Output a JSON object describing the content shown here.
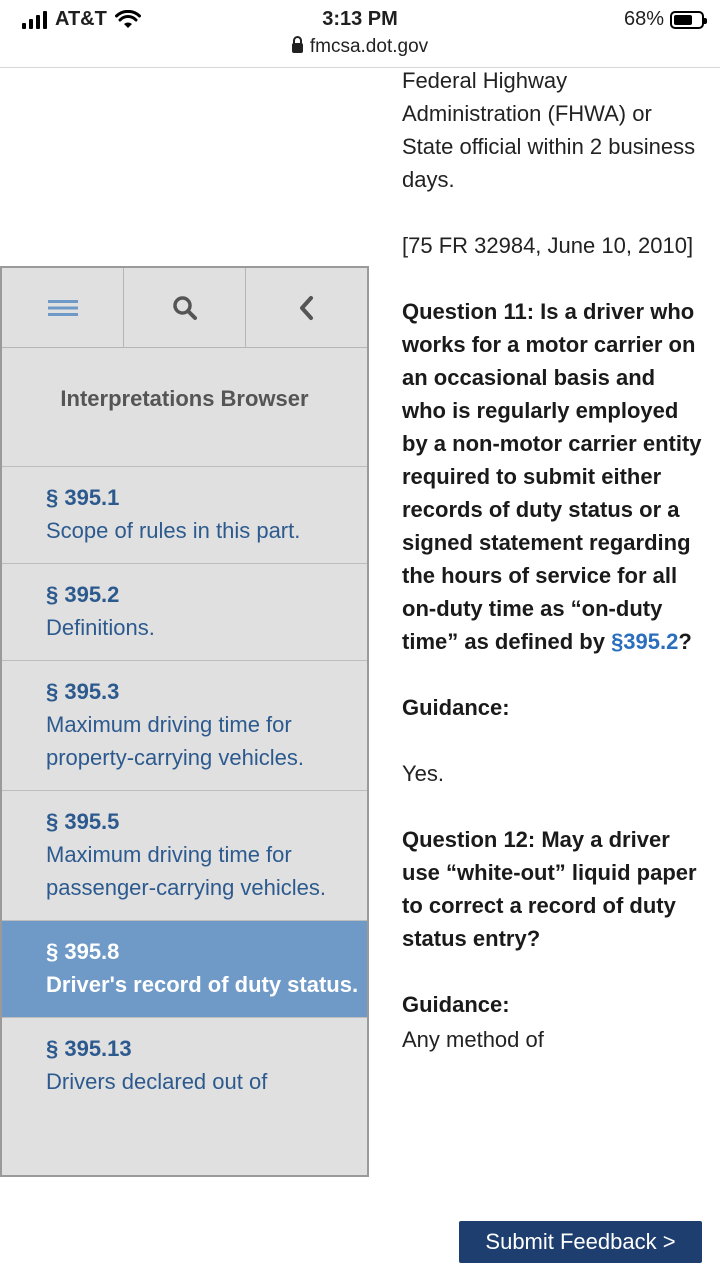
{
  "status_bar": {
    "carrier": "AT&T",
    "time": "3:13 PM",
    "battery": "68%",
    "battery_level": 0.68,
    "url": "fmcsa.dot.gov"
  },
  "content": {
    "paragraphs": [
      "Federal Highway Administration (FHWA) or State official within 2 business days.",
      "[75 FR 32984, June 10, 2010]"
    ],
    "question11_text": "Question 11: Is a driver who works for a motor carrier on an occasional basis and who is regularly employed by a non-motor carrier entity required to submit either records of duty status or a signed statement regarding the hours of service for all on-duty time as “on-duty time” as defined by ",
    "question11_link": "§395.2",
    "question11_end": "?",
    "guidance1_label": "Guidance:",
    "guidance1_answer": "Yes.",
    "question12_text": "Question 12: May a driver use “white-out” liquid paper to correct a record of duty status entry?",
    "guidance2_label": "Guidance:",
    "trailing_text": "Any method of"
  },
  "sidebar": {
    "heading": "Interpretations Browser",
    "items": [
      {
        "num": "§ 395.1",
        "desc": "Scope of rules in this part."
      },
      {
        "num": "§ 395.2",
        "desc": "Definitions."
      },
      {
        "num": "§ 395.3",
        "desc": "Maximum driving time for property-carrying vehicles."
      },
      {
        "num": "§ 395.5",
        "desc": "Maximum driving time for passenger-carrying vehicles."
      },
      {
        "num": "§ 395.8",
        "desc": "Driver's record of duty status."
      },
      {
        "num": "§ 395.13",
        "desc": "Drivers declared out of"
      }
    ]
  },
  "feedback_button": "Submit Feedback >",
  "colors": {
    "link": "#2a6ebd",
    "active_item": "#6f9ac7",
    "feedback_bg": "#1d3e6e"
  }
}
